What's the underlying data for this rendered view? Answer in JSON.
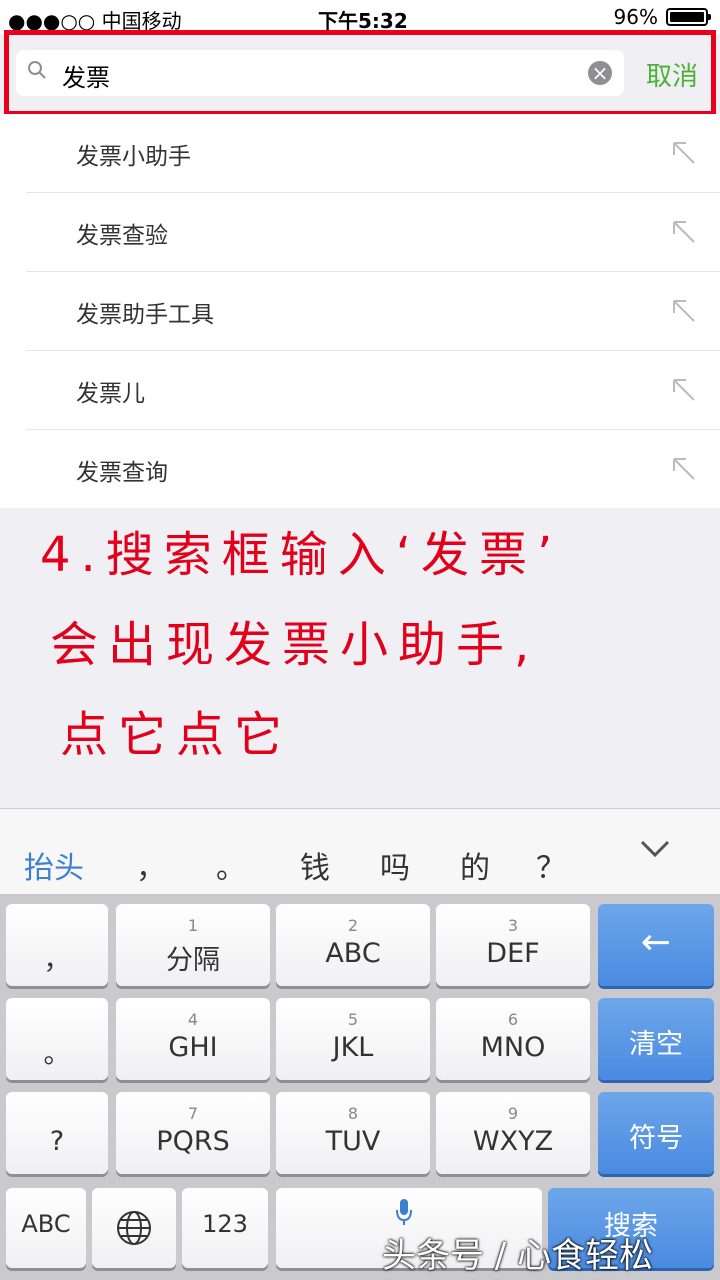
{
  "status": {
    "carrier": "●●●○○ 中国移动",
    "time": "下午5:32",
    "battery": "96%"
  },
  "search": {
    "query": "发票",
    "cancel_label": "取消"
  },
  "suggestions": [
    {
      "label": "发票小助手"
    },
    {
      "label": "发票查验"
    },
    {
      "label": "发票助手工具"
    },
    {
      "label": "发票儿"
    },
    {
      "label": "发票查询"
    }
  ],
  "annotation": {
    "line1": "4.搜索框输入‘发票’",
    "line2": "会出现发票小助手,",
    "line3": "点它点它"
  },
  "candidates": {
    "first": "抬头",
    "items": [
      "，",
      "。",
      "钱",
      "吗",
      "的",
      "？"
    ]
  },
  "keyboard": {
    "rows": [
      {
        "left": "，",
        "keys": [
          {
            "num": "1",
            "label": "分隔"
          },
          {
            "num": "2",
            "label": "ABC"
          },
          {
            "num": "3",
            "label": "DEF"
          }
        ],
        "right": "←"
      },
      {
        "left": "。",
        "keys": [
          {
            "num": "4",
            "label": "GHI"
          },
          {
            "num": "5",
            "label": "JKL"
          },
          {
            "num": "6",
            "label": "MNO"
          }
        ],
        "right": "清空"
      },
      {
        "left": "?",
        "keys": [
          {
            "num": "7",
            "label": "PQRS"
          },
          {
            "num": "8",
            "label": "TUV"
          },
          {
            "num": "9",
            "label": "WXYZ"
          }
        ],
        "right": "符号"
      }
    ],
    "bottom": {
      "abc": "ABC",
      "num": "123",
      "search": "搜索"
    }
  },
  "watermark": "头条号 / 心食轻松",
  "colors": {
    "accent_green": "#4cb137",
    "annotation_red": "#e2001a",
    "highlight_box": "#e8001c",
    "key_blue": "#4a8ae0"
  }
}
